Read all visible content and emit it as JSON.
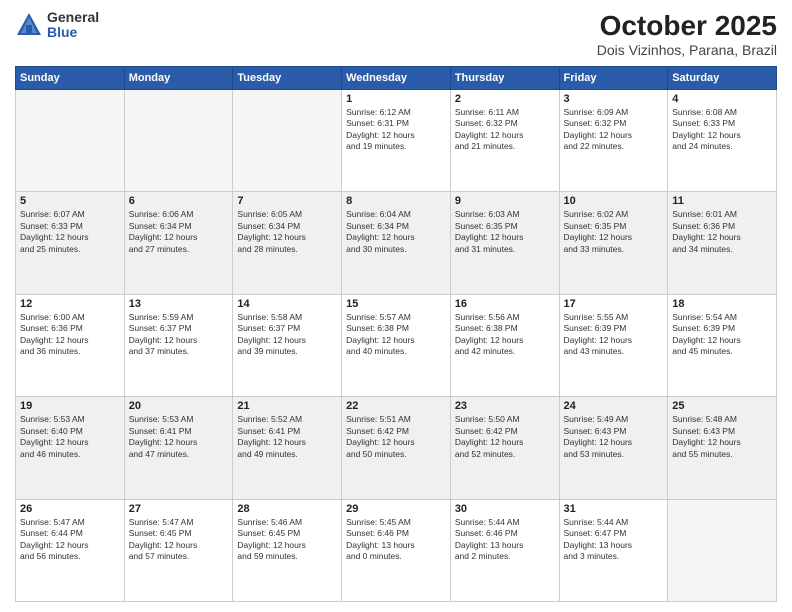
{
  "header": {
    "logo_general": "General",
    "logo_blue": "Blue",
    "month_title": "October 2025",
    "location": "Dois Vizinhos, Parana, Brazil"
  },
  "weekdays": [
    "Sunday",
    "Monday",
    "Tuesday",
    "Wednesday",
    "Thursday",
    "Friday",
    "Saturday"
  ],
  "weeks": [
    [
      {
        "day": "",
        "info": ""
      },
      {
        "day": "",
        "info": ""
      },
      {
        "day": "",
        "info": ""
      },
      {
        "day": "1",
        "info": "Sunrise: 6:12 AM\nSunset: 6:31 PM\nDaylight: 12 hours\nand 19 minutes."
      },
      {
        "day": "2",
        "info": "Sunrise: 6:11 AM\nSunset: 6:32 PM\nDaylight: 12 hours\nand 21 minutes."
      },
      {
        "day": "3",
        "info": "Sunrise: 6:09 AM\nSunset: 6:32 PM\nDaylight: 12 hours\nand 22 minutes."
      },
      {
        "day": "4",
        "info": "Sunrise: 6:08 AM\nSunset: 6:33 PM\nDaylight: 12 hours\nand 24 minutes."
      }
    ],
    [
      {
        "day": "5",
        "info": "Sunrise: 6:07 AM\nSunset: 6:33 PM\nDaylight: 12 hours\nand 25 minutes."
      },
      {
        "day": "6",
        "info": "Sunrise: 6:06 AM\nSunset: 6:34 PM\nDaylight: 12 hours\nand 27 minutes."
      },
      {
        "day": "7",
        "info": "Sunrise: 6:05 AM\nSunset: 6:34 PM\nDaylight: 12 hours\nand 28 minutes."
      },
      {
        "day": "8",
        "info": "Sunrise: 6:04 AM\nSunset: 6:34 PM\nDaylight: 12 hours\nand 30 minutes."
      },
      {
        "day": "9",
        "info": "Sunrise: 6:03 AM\nSunset: 6:35 PM\nDaylight: 12 hours\nand 31 minutes."
      },
      {
        "day": "10",
        "info": "Sunrise: 6:02 AM\nSunset: 6:35 PM\nDaylight: 12 hours\nand 33 minutes."
      },
      {
        "day": "11",
        "info": "Sunrise: 6:01 AM\nSunset: 6:36 PM\nDaylight: 12 hours\nand 34 minutes."
      }
    ],
    [
      {
        "day": "12",
        "info": "Sunrise: 6:00 AM\nSunset: 6:36 PM\nDaylight: 12 hours\nand 36 minutes."
      },
      {
        "day": "13",
        "info": "Sunrise: 5:59 AM\nSunset: 6:37 PM\nDaylight: 12 hours\nand 37 minutes."
      },
      {
        "day": "14",
        "info": "Sunrise: 5:58 AM\nSunset: 6:37 PM\nDaylight: 12 hours\nand 39 minutes."
      },
      {
        "day": "15",
        "info": "Sunrise: 5:57 AM\nSunset: 6:38 PM\nDaylight: 12 hours\nand 40 minutes."
      },
      {
        "day": "16",
        "info": "Sunrise: 5:56 AM\nSunset: 6:38 PM\nDaylight: 12 hours\nand 42 minutes."
      },
      {
        "day": "17",
        "info": "Sunrise: 5:55 AM\nSunset: 6:39 PM\nDaylight: 12 hours\nand 43 minutes."
      },
      {
        "day": "18",
        "info": "Sunrise: 5:54 AM\nSunset: 6:39 PM\nDaylight: 12 hours\nand 45 minutes."
      }
    ],
    [
      {
        "day": "19",
        "info": "Sunrise: 5:53 AM\nSunset: 6:40 PM\nDaylight: 12 hours\nand 46 minutes."
      },
      {
        "day": "20",
        "info": "Sunrise: 5:53 AM\nSunset: 6:41 PM\nDaylight: 12 hours\nand 47 minutes."
      },
      {
        "day": "21",
        "info": "Sunrise: 5:52 AM\nSunset: 6:41 PM\nDaylight: 12 hours\nand 49 minutes."
      },
      {
        "day": "22",
        "info": "Sunrise: 5:51 AM\nSunset: 6:42 PM\nDaylight: 12 hours\nand 50 minutes."
      },
      {
        "day": "23",
        "info": "Sunrise: 5:50 AM\nSunset: 6:42 PM\nDaylight: 12 hours\nand 52 minutes."
      },
      {
        "day": "24",
        "info": "Sunrise: 5:49 AM\nSunset: 6:43 PM\nDaylight: 12 hours\nand 53 minutes."
      },
      {
        "day": "25",
        "info": "Sunrise: 5:48 AM\nSunset: 6:43 PM\nDaylight: 12 hours\nand 55 minutes."
      }
    ],
    [
      {
        "day": "26",
        "info": "Sunrise: 5:47 AM\nSunset: 6:44 PM\nDaylight: 12 hours\nand 56 minutes."
      },
      {
        "day": "27",
        "info": "Sunrise: 5:47 AM\nSunset: 6:45 PM\nDaylight: 12 hours\nand 57 minutes."
      },
      {
        "day": "28",
        "info": "Sunrise: 5:46 AM\nSunset: 6:45 PM\nDaylight: 12 hours\nand 59 minutes."
      },
      {
        "day": "29",
        "info": "Sunrise: 5:45 AM\nSunset: 6:46 PM\nDaylight: 13 hours\nand 0 minutes."
      },
      {
        "day": "30",
        "info": "Sunrise: 5:44 AM\nSunset: 6:46 PM\nDaylight: 13 hours\nand 2 minutes."
      },
      {
        "day": "31",
        "info": "Sunrise: 5:44 AM\nSunset: 6:47 PM\nDaylight: 13 hours\nand 3 minutes."
      },
      {
        "day": "",
        "info": ""
      }
    ]
  ],
  "gray_rows": [
    1,
    3
  ]
}
